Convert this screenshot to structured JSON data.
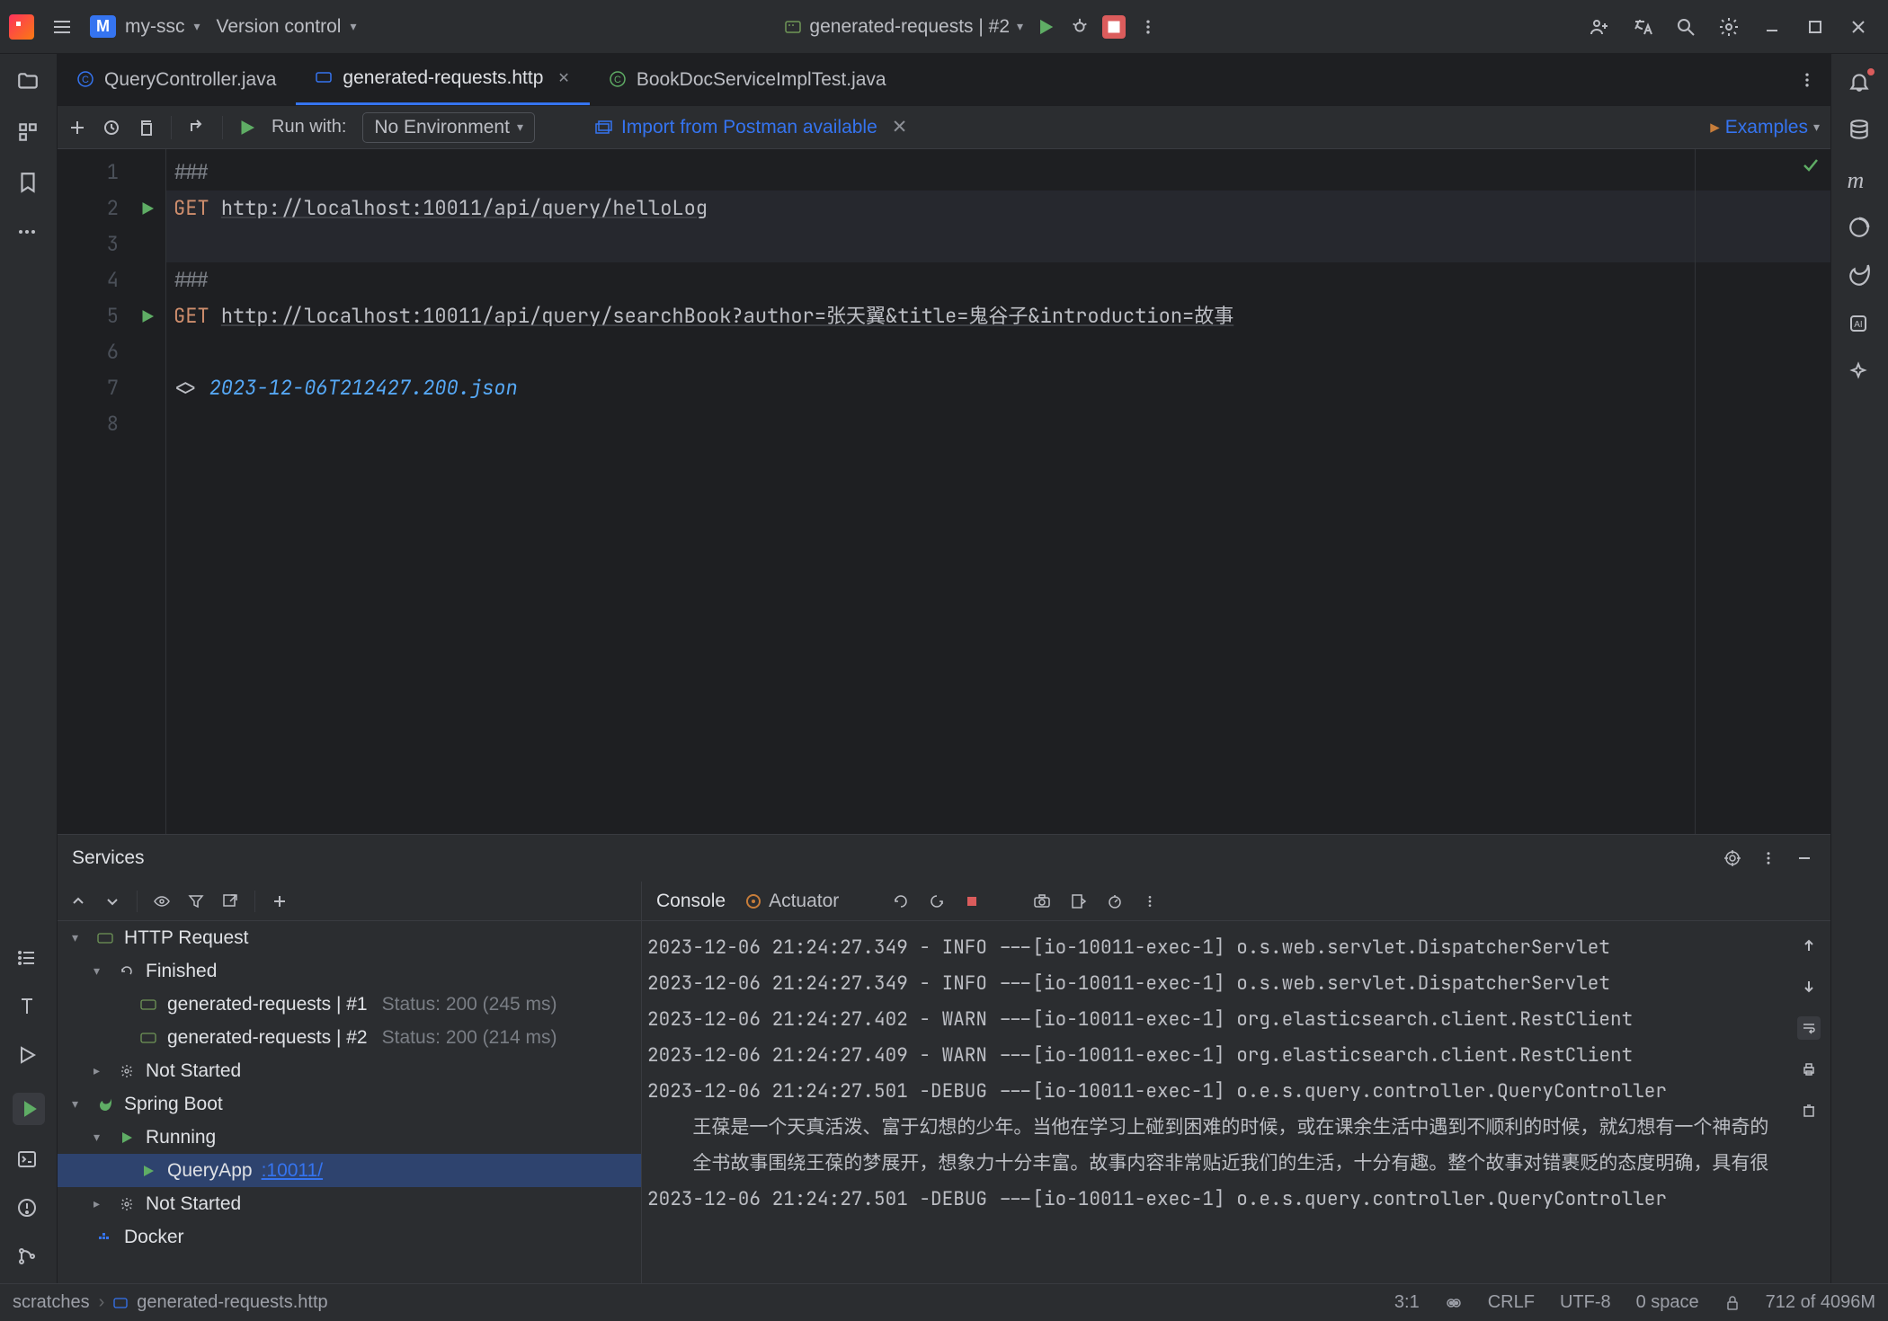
{
  "titlebar": {
    "project_badge": "M",
    "project_name": "my-ssc",
    "vcs_label": "Version control",
    "run_config": "generated-requests | #2"
  },
  "tabs": [
    {
      "name": "QueryController.java",
      "active": false,
      "closable": false,
      "icon": "copyright"
    },
    {
      "name": "generated-requests.http",
      "active": true,
      "closable": true,
      "icon": "http"
    },
    {
      "name": "BookDocServiceImplTest.java",
      "active": false,
      "closable": false,
      "icon": "copyright"
    }
  ],
  "editor_toolbar": {
    "run_with_label": "Run with:",
    "env_selected": "No Environment",
    "postman_label": "Import from Postman available",
    "examples_label": "Examples"
  },
  "editor": {
    "gutters": [
      "1",
      "2",
      "3",
      "4",
      "5",
      "6",
      "7",
      "8"
    ],
    "run_markers": [
      false,
      true,
      false,
      false,
      true,
      false,
      false,
      false
    ],
    "lines": [
      {
        "kind": "comment",
        "text": "###"
      },
      {
        "kind": "request",
        "method": "GET",
        "url": "http://localhost:10011/api/query/helloLog",
        "hl": true
      },
      {
        "kind": "blank",
        "hl": true
      },
      {
        "kind": "comment",
        "text": "###"
      },
      {
        "kind": "request",
        "method": "GET",
        "url": "http://localhost:10011/api/query/searchBook?author=张天翼&title=鬼谷子&introduction=故事"
      },
      {
        "kind": "blank"
      },
      {
        "kind": "response",
        "prefix": "<> ",
        "file": "2023-12-06T212427.200.json"
      },
      {
        "kind": "blank"
      }
    ]
  },
  "services": {
    "title": "Services",
    "tree": [
      {
        "level": 0,
        "arrow": "down",
        "icon": "http",
        "label": "HTTP Request"
      },
      {
        "level": 1,
        "arrow": "down",
        "icon": "refresh",
        "label": "Finished"
      },
      {
        "level": 2,
        "arrow": "",
        "icon": "http",
        "label": "generated-requests | #1",
        "sub": "Status: 200 (245 ms)"
      },
      {
        "level": 2,
        "arrow": "",
        "icon": "http",
        "label": "generated-requests | #2",
        "sub": "Status: 200 (214 ms)"
      },
      {
        "level": 1,
        "arrow": "right",
        "icon": "gear",
        "label": "Not Started"
      },
      {
        "level": 0,
        "arrow": "down",
        "icon": "spring",
        "label": "Spring Boot"
      },
      {
        "level": 1,
        "arrow": "down",
        "icon": "play",
        "label": "Running"
      },
      {
        "level": 2,
        "arrow": "",
        "icon": "play",
        "label": "QueryApp",
        "port": ":10011/",
        "selected": true
      },
      {
        "level": 1,
        "arrow": "right",
        "icon": "gear",
        "label": "Not Started"
      },
      {
        "level": 0,
        "arrow": "",
        "icon": "docker",
        "label": "Docker"
      }
    ],
    "console_tab": "Console",
    "actuator_tab": "Actuator",
    "console_lines": [
      "2023-12-06 21:24:27.349 - INFO ---[io-10011-exec-1] o.s.web.servlet.DispatcherServlet",
      "2023-12-06 21:24:27.349 - INFO ---[io-10011-exec-1] o.s.web.servlet.DispatcherServlet",
      "2023-12-06 21:24:27.402 - WARN ---[io-10011-exec-1] org.elasticsearch.client.RestClient",
      "2023-12-06 21:24:27.409 - WARN ---[io-10011-exec-1] org.elasticsearch.client.RestClient",
      "2023-12-06 21:24:27.501 -DEBUG ---[io-10011-exec-1] o.e.s.query.controller.QueryController",
      "    王葆是一个天真活泼、富于幻想的少年。当他在学习上碰到困难的时候，或在课余生活中遇到不顺利的时候，就幻想有一个神奇的",
      "    全书故事围绕王葆的梦展开，想象力十分丰富。故事内容非常贴近我们的生活，十分有趣。整个故事对错裹贬的态度明确，具有很",
      "2023-12-06 21:24:27.501 -DEBUG ---[io-10011-exec-1] o.e.s.query.controller.QueryController"
    ]
  },
  "statusbar": {
    "crumb_root": "scratches",
    "crumb_file": "generated-requests.http",
    "cursor": "3:1",
    "line_sep": "CRLF",
    "encoding": "UTF-8",
    "indent": "0 space",
    "memory": "712 of 4096M"
  }
}
